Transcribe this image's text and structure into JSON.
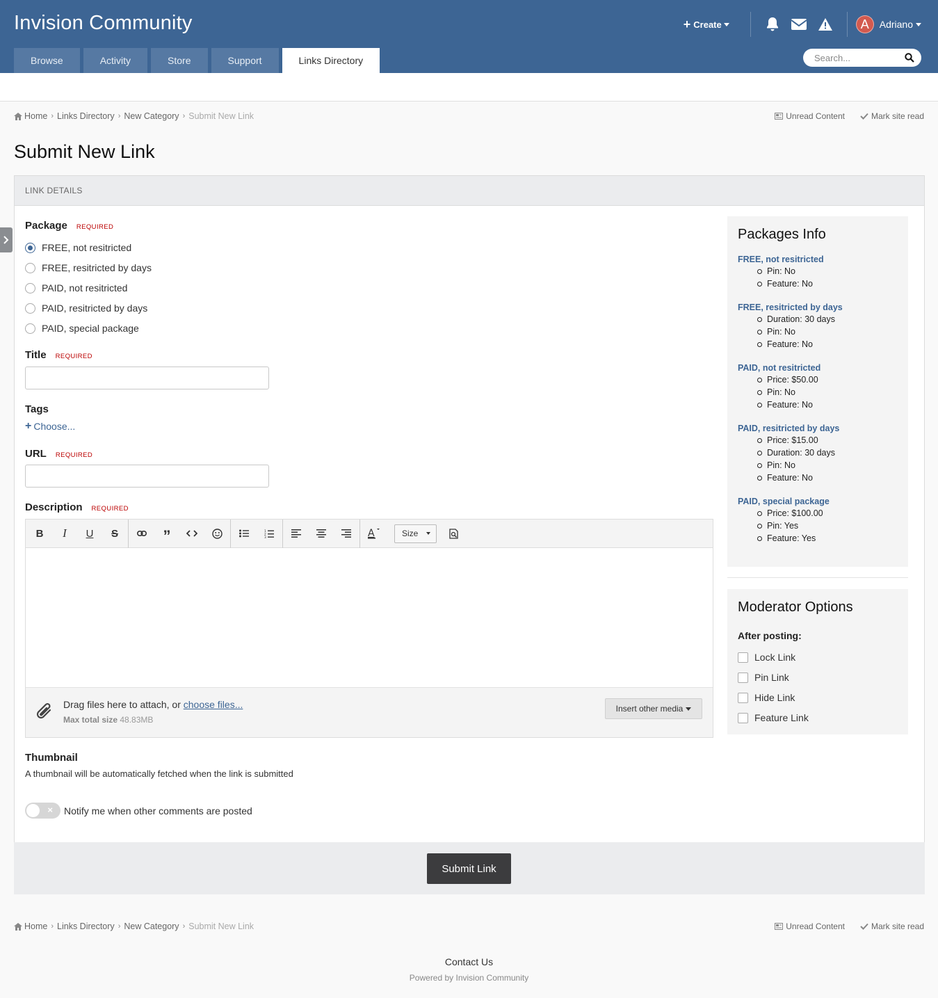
{
  "header": {
    "site_title": "Invision Community",
    "create_label": "Create",
    "username": "Adriano",
    "avatar_letter": "A",
    "search_placeholder": "Search..."
  },
  "nav": {
    "tabs": [
      {
        "label": "Browse"
      },
      {
        "label": "Activity"
      },
      {
        "label": "Store"
      },
      {
        "label": "Support"
      },
      {
        "label": "Links Directory",
        "active": true
      }
    ]
  },
  "breadcrumb": {
    "items": [
      "Home",
      "Links Directory",
      "New Category",
      "Submit New Link"
    ],
    "unread": "Unread Content",
    "mark_read": "Mark site read"
  },
  "page": {
    "title": "Submit New Link",
    "section_header": "LINK DETAILS"
  },
  "form": {
    "required_tag": "REQUIRED",
    "package_label": "Package",
    "packages": [
      {
        "label": "FREE, not resitricted",
        "checked": true
      },
      {
        "label": "FREE, resitricted by days",
        "checked": false
      },
      {
        "label": "PAID, not resitricted",
        "checked": false
      },
      {
        "label": "PAID, resitricted by days",
        "checked": false
      },
      {
        "label": "PAID, special package",
        "checked": false
      }
    ],
    "title_label": "Title",
    "title_value": "",
    "tags_label": "Tags",
    "tags_choose": "Choose...",
    "url_label": "URL",
    "url_value": "",
    "description_label": "Description",
    "size_label": "Size",
    "attach_text": "Drag files here to attach, or ",
    "attach_link": "choose files...",
    "max_size_label": "Max total size",
    "max_size_value": "48.83MB",
    "insert_media": "Insert other media",
    "thumbnail_label": "Thumbnail",
    "thumbnail_note": "A thumbnail will be automatically fetched when the link is submitted",
    "notify_label": "Notify me when other comments are posted",
    "submit_label": "Submit Link"
  },
  "sidebar": {
    "packages_title": "Packages Info",
    "packages": [
      {
        "name": "FREE, not resitricted",
        "details": [
          "Pin: No",
          "Feature: No"
        ]
      },
      {
        "name": "FREE, resitricted by days",
        "details": [
          "Duration: 30 days",
          "Pin: No",
          "Feature: No"
        ]
      },
      {
        "name": "PAID, not resitricted",
        "details": [
          "Price: $50.00",
          "Pin: No",
          "Feature: No"
        ]
      },
      {
        "name": "PAID, resitricted by days",
        "details": [
          "Price: $15.00",
          "Duration: 30 days",
          "Pin: No",
          "Feature: No"
        ]
      },
      {
        "name": "PAID, special package",
        "details": [
          "Price: $100.00",
          "Pin: Yes",
          "Feature: Yes"
        ]
      }
    ],
    "moderator_title": "Moderator Options",
    "after_posting": "After posting:",
    "options": [
      "Lock Link",
      "Pin Link",
      "Hide Link",
      "Feature Link"
    ]
  },
  "footer": {
    "contact": "Contact Us",
    "powered": "Powered by Invision Community"
  },
  "colors": {
    "brand": "#3d6594",
    "required": "#bb0000",
    "submit": "#3c3c3e"
  }
}
